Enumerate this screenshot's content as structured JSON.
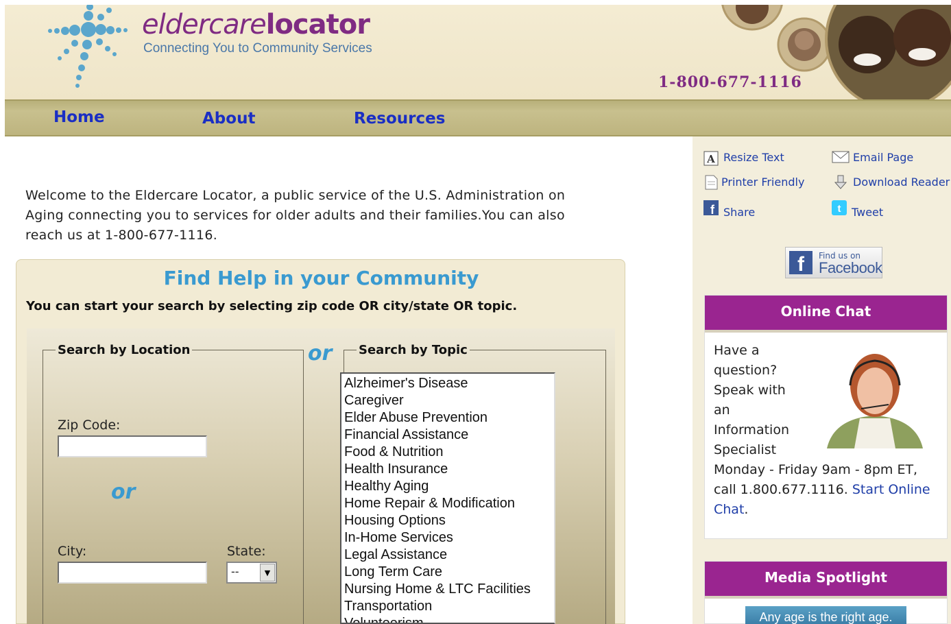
{
  "header": {
    "brand_word1": "eldercare",
    "brand_word2": "locator",
    "tagline": "Connecting You to Community Services",
    "phone": "1-800-677-1116"
  },
  "nav": {
    "items": [
      {
        "label": "Home"
      },
      {
        "label": "About"
      },
      {
        "label": "Resources"
      }
    ]
  },
  "welcome": "Welcome to the Eldercare Locator, a public service of the U.S. Administration on Aging connecting you to services for older adults and their families.You can also reach us at 1-800-677-1116.",
  "find": {
    "title": "Find Help in your Community",
    "instructions": "You can start your search by selecting zip code OR city/state OR topic.",
    "or_label": "or",
    "location": {
      "legend": "Search by Location",
      "zip_label": "Zip Code:",
      "zip_value": "",
      "or_label": "or",
      "city_label": "City:",
      "city_value": "",
      "state_label": "State:",
      "state_value": "--"
    },
    "topic": {
      "legend": "Search by Topic",
      "options": [
        "Alzheimer's Disease",
        "Caregiver",
        "Elder Abuse Prevention",
        "Financial Assistance",
        "Food & Nutrition",
        "Health Insurance",
        "Healthy Aging",
        "Home Repair & Modification",
        "Housing Options",
        "In-Home Services",
        "Legal Assistance",
        "Long Term Care",
        "Nursing Home & LTC Facilities",
        "Transportation",
        "Volunteerism"
      ]
    }
  },
  "sidebar": {
    "tools": {
      "resize": "Resize Text",
      "email": "Email Page",
      "print": "Printer Friendly",
      "download": "Download Reader",
      "share": "Share",
      "tweet": "Tweet"
    },
    "facebook": {
      "line1": "Find us on",
      "line2": "Facebook",
      "glyph": "f"
    },
    "chat": {
      "title": "Online Chat",
      "text_short": [
        "Have a",
        "question?",
        "Speak with",
        "an",
        "Information",
        "Specialist"
      ],
      "text_long": "Monday - Friday 9am - 8pm ET, call 1.800.677.1116.",
      "link": "Start Online Chat",
      "end": "."
    },
    "media": {
      "title": "Media Spotlight",
      "banner": "Any age is the right age."
    }
  },
  "colors": {
    "purple": "#9a2590",
    "blue_link": "#1f3ea8",
    "title_blue": "#3a9ad0",
    "nav_bg": "#bdb47f"
  }
}
